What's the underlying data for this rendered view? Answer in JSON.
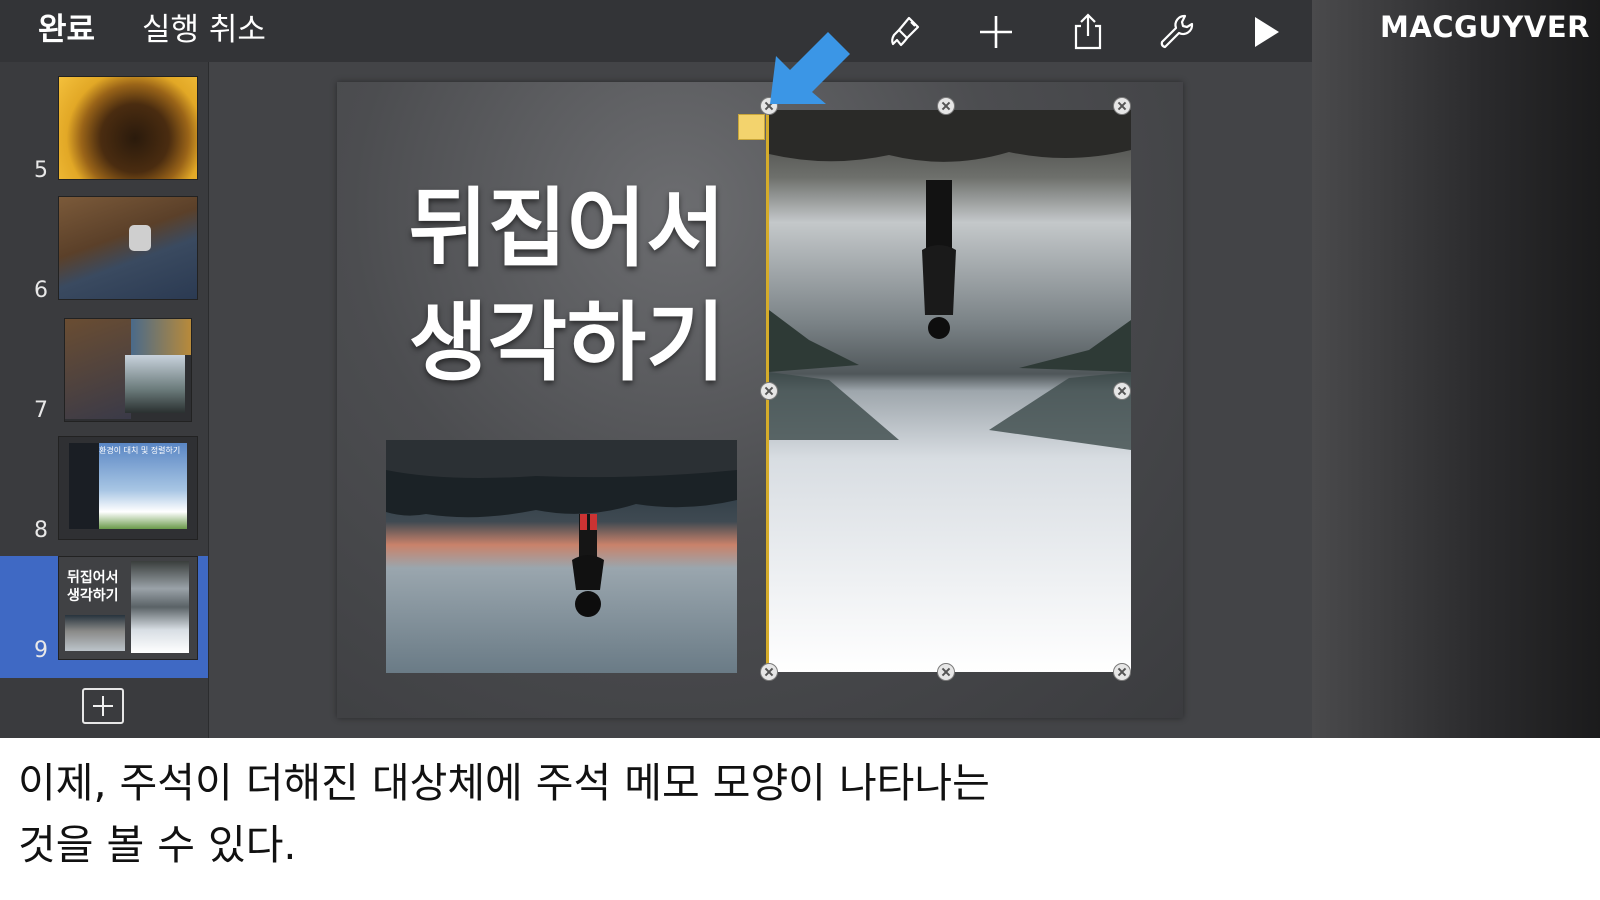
{
  "toolbar": {
    "done_label": "완료",
    "undo_label": "실행 취소",
    "icons": [
      "paintbrush-icon",
      "plus-icon",
      "share-icon",
      "wrench-icon",
      "play-icon"
    ]
  },
  "brand": "MACGUYVER",
  "sidebar": {
    "slides": [
      {
        "number": "5",
        "thumb_text": ""
      },
      {
        "number": "6",
        "thumb_text": ""
      },
      {
        "number": "7",
        "thumb_text": ""
      },
      {
        "number": "8",
        "thumb_text": "환경이 대치 및 정렬하기"
      },
      {
        "number": "9",
        "thumb_text": "뒤집어서 생각하기"
      }
    ],
    "selected_number": "9"
  },
  "slide": {
    "title_line1": "뒤집어서",
    "title_line2": "생각하기"
  },
  "colors": {
    "toolbar_bg": "#333437",
    "selection_blue": "#3f69c4",
    "annotation_line": "#d5ac2a",
    "comment_yellow": "#f3d36d",
    "arrow_blue": "#3b96e6"
  },
  "caption": {
    "line1": "이제, 주석이 더해진 대상체에 주석 메모 모양이 나타나는",
    "line2": "것을 볼 수 있다."
  }
}
